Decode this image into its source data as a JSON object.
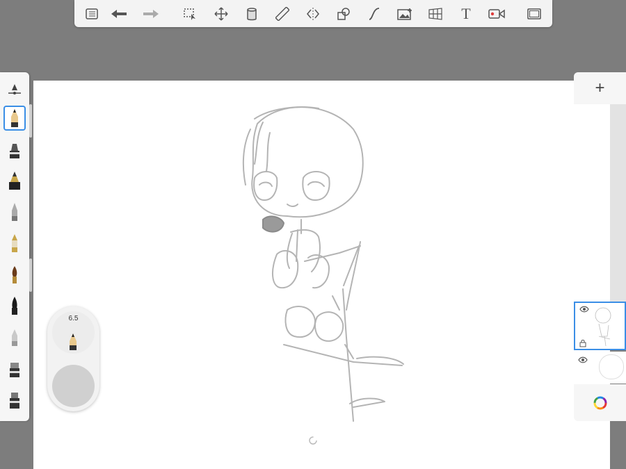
{
  "toolbar": {
    "items": [
      {
        "name": "list-icon"
      },
      {
        "name": "undo-icon"
      },
      {
        "name": "redo-icon"
      },
      {
        "name": "selection-icon"
      },
      {
        "name": "transform-icon"
      },
      {
        "name": "fill-icon"
      },
      {
        "name": "ruler-icon"
      },
      {
        "name": "symmetry-icon"
      },
      {
        "name": "shape-icon"
      },
      {
        "name": "curve-icon"
      },
      {
        "name": "image-icon"
      },
      {
        "name": "perspective-icon"
      },
      {
        "name": "text-icon",
        "label": "T"
      },
      {
        "name": "record-icon"
      },
      {
        "name": "fullscreen-icon"
      }
    ]
  },
  "brush_panel": {
    "selected_index": 1,
    "brushes": [
      "opacity-slider-icon",
      "pencil-icon",
      "marker-icon",
      "technical-pen-icon",
      "airbrush-icon",
      "fountain-pen-icon",
      "paintbrush-icon",
      "ink-brush-icon",
      "soft-eraser-icon",
      "eraser-icon",
      "hard-eraser-icon"
    ]
  },
  "puck": {
    "size_value": "6.5",
    "color": "#d0d0d0"
  },
  "layers": {
    "add_label": "+",
    "items": [
      {
        "name": "layer-sketch",
        "active": true,
        "visible": true
      },
      {
        "name": "layer-paper",
        "active": false,
        "visible": true
      }
    ]
  },
  "colors": {
    "accent": "#3a8ee6",
    "background": "#7d7d7d",
    "canvas": "#ffffff",
    "panel": "#f6f6f6"
  }
}
